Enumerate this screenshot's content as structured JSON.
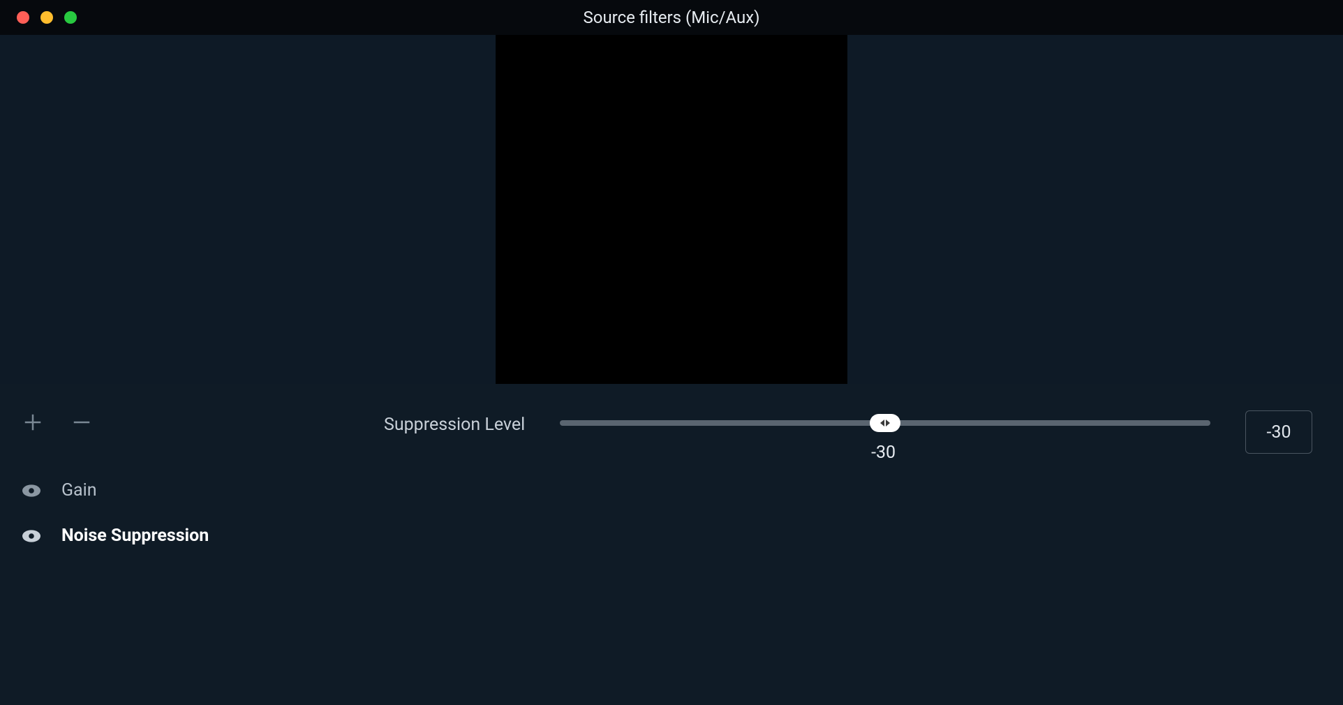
{
  "window": {
    "title": "Source filters (Mic/Aux)"
  },
  "sidebar": {
    "filters": [
      {
        "label": "Gain",
        "active": false
      },
      {
        "label": "Noise Suppression",
        "active": true
      }
    ]
  },
  "panel": {
    "param_label": "Suppression Level",
    "slider_value": "-30",
    "slider_min": -60,
    "slider_max": 0,
    "slider_pos_percent": 50,
    "value_box": "-30"
  }
}
